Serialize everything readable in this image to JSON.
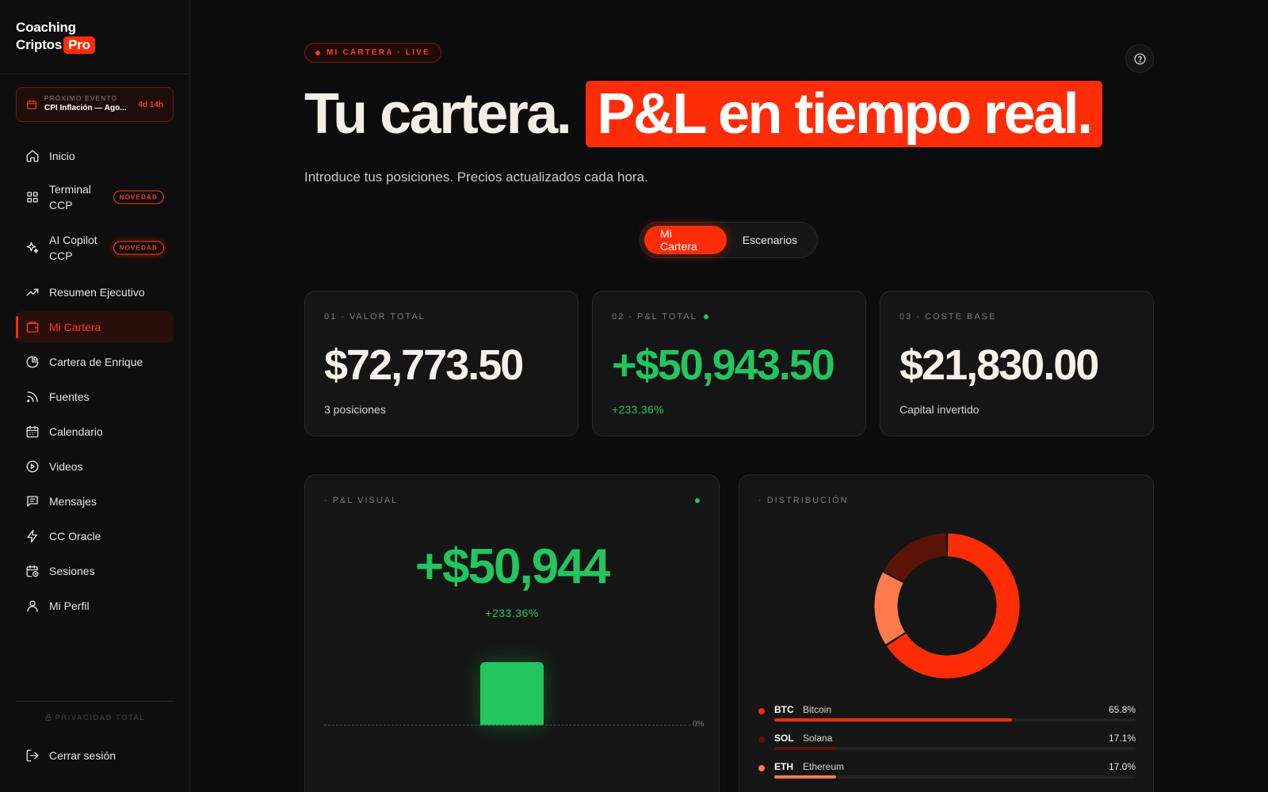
{
  "brand": {
    "line1": "Coaching",
    "line2": "Criptos",
    "pro": "Pro"
  },
  "event": {
    "kicker": "PRÓXIMO EVENTO",
    "name": "CPI Inflación — Ago...",
    "countdown": "4d 14h"
  },
  "nav": [
    {
      "label": "Inicio",
      "icon": "home-icon"
    },
    {
      "label": "Terminal CCP",
      "icon": "grid-icon",
      "badge": "NOVEDAD"
    },
    {
      "label": "AI Copilot CCP",
      "icon": "sparkles-icon",
      "badge": "NOVEDAD"
    },
    {
      "label": "Resumen Ejecutivo",
      "icon": "trending-up-icon"
    },
    {
      "label": "Mi Cartera",
      "icon": "wallet-icon",
      "active": true
    },
    {
      "label": "Cartera de Enrique",
      "icon": "pie-chart-icon"
    },
    {
      "label": "Fuentes",
      "icon": "rss-icon"
    },
    {
      "label": "Calendario",
      "icon": "calendar-icon"
    },
    {
      "label": "Videos",
      "icon": "play-circle-icon"
    },
    {
      "label": "Mensajes",
      "icon": "message-icon"
    },
    {
      "label": "CC Oracle",
      "icon": "zap-icon"
    },
    {
      "label": "Sesiones",
      "icon": "calendar-clock-icon"
    },
    {
      "label": "Mi Perfil",
      "icon": "user-icon"
    }
  ],
  "privacy": "PRIVACIDAD TOTAL",
  "logout": "Cerrar sesión",
  "header": {
    "live_badge": "MI CARTERA · LIVE",
    "title_plain": "Tu cartera.",
    "title_highlight": "P&L en tiempo real.",
    "subtitle": "Introduce tus posiciones. Precios actualizados cada hora."
  },
  "tabs": [
    {
      "label": "Mi Cartera",
      "active": true
    },
    {
      "label": "Escenarios",
      "active": false
    }
  ],
  "kpis": [
    {
      "label": "01 · VALOR TOTAL",
      "value": "$72,773.50",
      "sub": "3 posiciones"
    },
    {
      "label": "02 · P&L TOTAL",
      "value": "+$50,943.50",
      "sub": "+233.36%"
    },
    {
      "label": "03 · COSTE BASE",
      "value": "$21,830.00",
      "sub": "Capital invertido"
    }
  ],
  "pnl_visual": {
    "label": "· P&L VISUAL",
    "value": "+$50,944",
    "percent": "+233.36%",
    "zero_label": "0%"
  },
  "distribution": {
    "label": "· DISTRIBUCIÓN",
    "assets": [
      {
        "symbol": "BTC",
        "name": "Bitcoin",
        "percent_label": "65.8%",
        "share": 65.8,
        "color": "#ff2d07"
      },
      {
        "symbol": "SOL",
        "name": "Solana",
        "percent_label": "17.1%",
        "share": 17.1,
        "color": "#5c1408"
      },
      {
        "symbol": "ETH",
        "name": "Ethereum",
        "percent_label": "17.0%",
        "share": 17.0,
        "color": "#ff7a4d"
      }
    ]
  },
  "colors": {
    "accent": "#ff2d07",
    "positive": "#22c55e",
    "background": "#0c0c0c",
    "card": "#151515"
  }
}
